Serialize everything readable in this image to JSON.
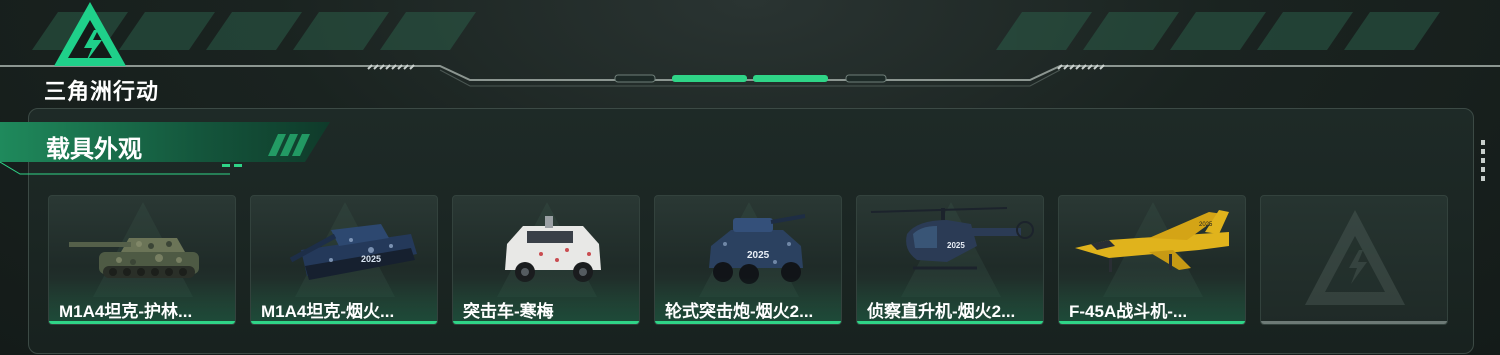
{
  "header": {
    "logo_text": "三角洲行动"
  },
  "section": {
    "title": "载具外观"
  },
  "cards": [
    {
      "label": "M1A4坦克-护林...",
      "icon": "tank-icon",
      "color": "#5e6a4d"
    },
    {
      "label": "M1A4坦克-烟火...",
      "icon": "tank-icon",
      "color": "#243b5e"
    },
    {
      "label": "突击车-寒梅",
      "icon": "armored-car-icon",
      "color": "#e6e6e6"
    },
    {
      "label": "轮式突击炮-烟火2...",
      "icon": "armored-car-icon",
      "color": "#2c4260"
    },
    {
      "label": "侦察直升机-烟火2...",
      "icon": "helicopter-icon",
      "color": "#2b3b55"
    },
    {
      "label": "F-45A战斗机-...",
      "icon": "fighter-jet-icon",
      "color": "#e0b31c"
    },
    {
      "label": "",
      "icon": "placeholder-logo-icon",
      "color": "#6d7a76"
    }
  ],
  "colors": {
    "accent": "#2fd487",
    "panel_border": "#3c4a45",
    "background": "#161e1c"
  }
}
